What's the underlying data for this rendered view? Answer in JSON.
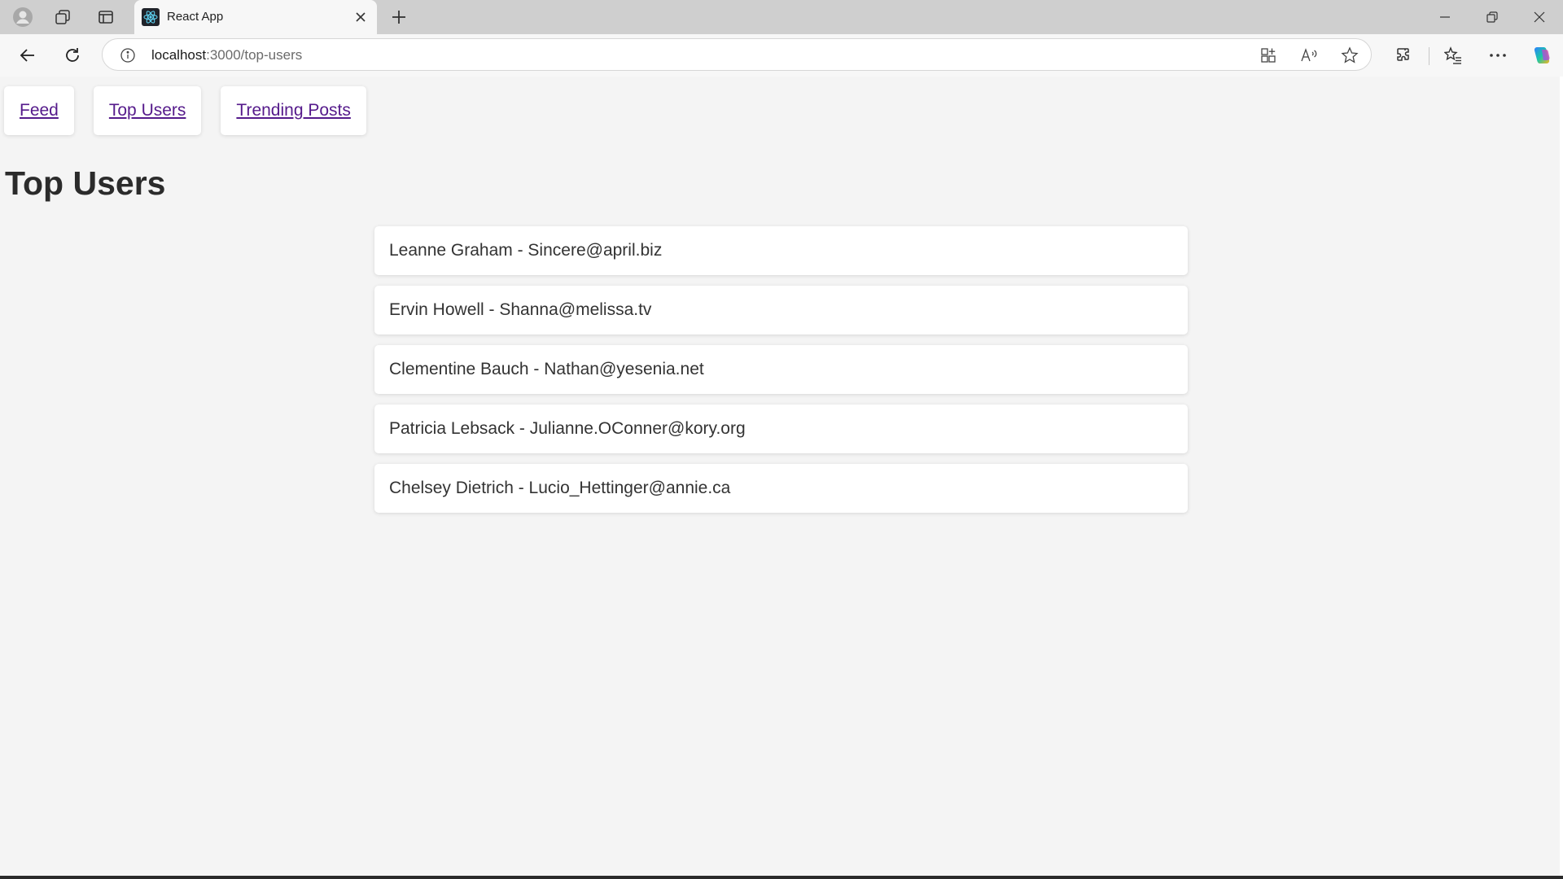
{
  "browser": {
    "tab_title": "React App",
    "url_host": "localhost",
    "url_path": ":3000/top-users"
  },
  "icons": {
    "profile": "profile-icon",
    "workspaces": "workspaces-icon",
    "vertical_tabs": "vertical-tabs-icon",
    "favicon": "react-favicon-icon",
    "close_tab": "close-icon",
    "new_tab": "plus-icon",
    "back": "back-arrow-icon",
    "refresh": "refresh-icon",
    "site_info": "info-icon",
    "app_available": "app-grid-icon",
    "read_aloud": "read-aloud-icon",
    "favorite": "star-icon",
    "extensions": "puzzle-icon",
    "favorites": "favorites-list-icon",
    "more": "more-dots-icon",
    "copilot": "copilot-icon",
    "minimize": "minimize-icon",
    "restore": "restore-icon",
    "close_window": "close-window-icon"
  },
  "colors": {
    "link_visited": "#551a8b",
    "page_bg": "#f4f4f4",
    "card_bg": "#ffffff",
    "text": "#333333"
  },
  "nav": {
    "links": [
      {
        "label": "Feed"
      },
      {
        "label": "Top Users"
      },
      {
        "label": "Trending Posts"
      }
    ]
  },
  "page": {
    "title": "Top Users"
  },
  "users": [
    {
      "text": "Leanne Graham - Sincere@april.biz"
    },
    {
      "text": "Ervin Howell - Shanna@melissa.tv"
    },
    {
      "text": "Clementine Bauch - Nathan@yesenia.net"
    },
    {
      "text": "Patricia Lebsack - Julianne.OConner@kory.org"
    },
    {
      "text": "Chelsey Dietrich - Lucio_Hettinger@annie.ca"
    }
  ]
}
